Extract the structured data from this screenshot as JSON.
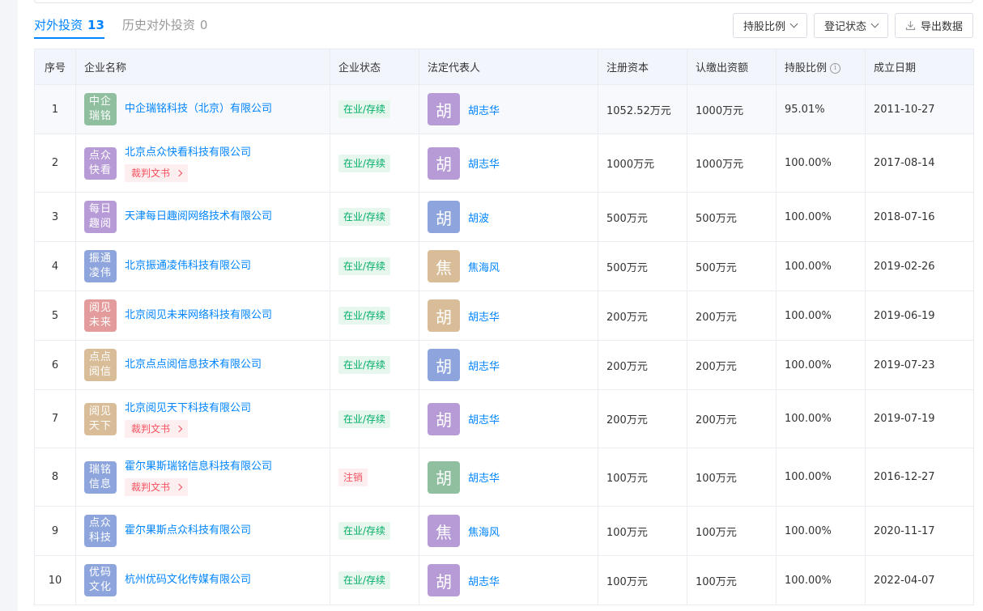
{
  "tabs": [
    {
      "label": "对外投资",
      "count": "13"
    },
    {
      "label": "历史对外投资",
      "count": "0"
    }
  ],
  "toolbar": {
    "filter_ratio": "持股比例",
    "filter_status": "登记状态",
    "export": "导出数据"
  },
  "columns": [
    "序号",
    "企业名称",
    "企业状态",
    "法定代表人",
    "注册资本",
    "认缴出资额",
    "持股比例",
    "成立日期"
  ],
  "info_icon": "i",
  "colors": {
    "accent": "#0084ff",
    "status_active_bg": "#e8f7ee",
    "status_active_fg": "#00ad65",
    "status_cancel_bg": "#fdeef0",
    "status_cancel_fg": "#f5515f"
  },
  "rows": [
    {
      "idx": "1",
      "logo": "中企瑞铭",
      "logo_color": "#8fbf9f",
      "name": "中企瑞铭科技（北京）有限公司",
      "doc": "",
      "status": "在业/存续",
      "status_type": "active",
      "rep_char": "胡",
      "rep_color": "#b69bd6",
      "rep": "胡志华",
      "capital": "1052.52万元",
      "subscribed": "1000万元",
      "ratio": "95.01%",
      "date": "2011-10-27"
    },
    {
      "idx": "2",
      "logo": "点众快看",
      "logo_color": "#b69bd6",
      "name": "北京点众快看科技有限公司",
      "doc": "裁判文书",
      "status": "在业/存续",
      "status_type": "active",
      "rep_char": "胡",
      "rep_color": "#b69bd6",
      "rep": "胡志华",
      "capital": "1000万元",
      "subscribed": "1000万元",
      "ratio": "100.00%",
      "date": "2017-08-14"
    },
    {
      "idx": "3",
      "logo": "每日趣阅",
      "logo_color": "#b69bd6",
      "name": "天津每日趣阅网络技术有限公司",
      "doc": "",
      "status": "在业/存续",
      "status_type": "active",
      "rep_char": "胡",
      "rep_color": "#8da5dc",
      "rep": "胡波",
      "capital": "500万元",
      "subscribed": "500万元",
      "ratio": "100.00%",
      "date": "2018-07-16"
    },
    {
      "idx": "4",
      "logo": "振通凌伟",
      "logo_color": "#8da5dc",
      "name": "北京振通凌伟科技有限公司",
      "doc": "",
      "status": "在业/存续",
      "status_type": "active",
      "rep_char": "焦",
      "rep_color": "#d8bd98",
      "rep": "焦海风",
      "capital": "500万元",
      "subscribed": "500万元",
      "ratio": "100.00%",
      "date": "2019-02-26"
    },
    {
      "idx": "5",
      "logo": "阅见未来",
      "logo_color": "#e49b9b",
      "name": "北京阅见未来网络科技有限公司",
      "doc": "",
      "status": "在业/存续",
      "status_type": "active",
      "rep_char": "胡",
      "rep_color": "#d8bd98",
      "rep": "胡志华",
      "capital": "200万元",
      "subscribed": "200万元",
      "ratio": "100.00%",
      "date": "2019-06-19"
    },
    {
      "idx": "6",
      "logo": "点点阅信",
      "logo_color": "#d8bd98",
      "name": "北京点点阅信息技术有限公司",
      "doc": "",
      "status": "在业/存续",
      "status_type": "active",
      "rep_char": "胡",
      "rep_color": "#8da5dc",
      "rep": "胡志华",
      "capital": "200万元",
      "subscribed": "200万元",
      "ratio": "100.00%",
      "date": "2019-07-23"
    },
    {
      "idx": "7",
      "logo": "阅见天下",
      "logo_color": "#d8bd98",
      "name": "北京阅见天下科技有限公司",
      "doc": "裁判文书",
      "status": "在业/存续",
      "status_type": "active",
      "rep_char": "胡",
      "rep_color": "#b69bd6",
      "rep": "胡志华",
      "capital": "200万元",
      "subscribed": "200万元",
      "ratio": "100.00%",
      "date": "2019-07-19"
    },
    {
      "idx": "8",
      "logo": "瑞铭信息",
      "logo_color": "#8da5dc",
      "name": "霍尔果斯瑞铭信息科技有限公司",
      "doc": "裁判文书",
      "status": "注销",
      "status_type": "cancel",
      "rep_char": "胡",
      "rep_color": "#8fbf9f",
      "rep": "胡志华",
      "capital": "100万元",
      "subscribed": "100万元",
      "ratio": "100.00%",
      "date": "2016-12-27"
    },
    {
      "idx": "9",
      "logo": "点众科技",
      "logo_color": "#8da5dc",
      "name": "霍尔果斯点众科技有限公司",
      "doc": "",
      "status": "在业/存续",
      "status_type": "active",
      "rep_char": "焦",
      "rep_color": "#b69bd6",
      "rep": "焦海风",
      "capital": "100万元",
      "subscribed": "100万元",
      "ratio": "100.00%",
      "date": "2020-11-17"
    },
    {
      "idx": "10",
      "logo": "优码文化",
      "logo_color": "#8da5dc",
      "name": "杭州优码文化传媒有限公司",
      "doc": "",
      "status": "在业/存续",
      "status_type": "active",
      "rep_char": "胡",
      "rep_color": "#b69bd6",
      "rep": "胡志华",
      "capital": "100万元",
      "subscribed": "100万元",
      "ratio": "100.00%",
      "date": "2022-04-07"
    }
  ]
}
